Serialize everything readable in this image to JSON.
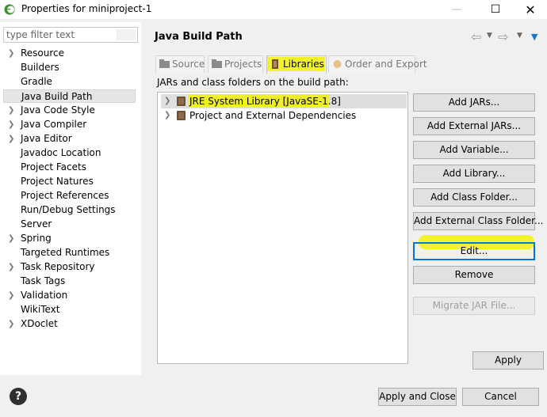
{
  "window": {
    "title": "Properties for miniproject-1",
    "minimize": "—",
    "maximize": "☐",
    "close": "✕"
  },
  "filter": {
    "placeholder": "type filter text"
  },
  "tree": [
    {
      "label": "Resource",
      "arrow": true
    },
    {
      "label": "Builders",
      "arrow": false
    },
    {
      "label": "Gradle",
      "arrow": false
    },
    {
      "label": "Java Build Path",
      "arrow": false,
      "selected": true
    },
    {
      "label": "Java Code Style",
      "arrow": true
    },
    {
      "label": "Java Compiler",
      "arrow": true
    },
    {
      "label": "Java Editor",
      "arrow": true
    },
    {
      "label": "Javadoc Location",
      "arrow": false
    },
    {
      "label": "Project Facets",
      "arrow": false
    },
    {
      "label": "Project Natures",
      "arrow": false
    },
    {
      "label": "Project References",
      "arrow": false
    },
    {
      "label": "Run/Debug Settings",
      "arrow": false
    },
    {
      "label": "Server",
      "arrow": false
    },
    {
      "label": "Spring",
      "arrow": true
    },
    {
      "label": "Targeted Runtimes",
      "arrow": false
    },
    {
      "label": "Task Repository",
      "arrow": true
    },
    {
      "label": "Task Tags",
      "arrow": false
    },
    {
      "label": "Validation",
      "arrow": true
    },
    {
      "label": "WikiText",
      "arrow": false
    },
    {
      "label": "XDoclet",
      "arrow": true
    }
  ],
  "page": {
    "title": "Java Build Path"
  },
  "tabs": [
    {
      "label": "Source",
      "icon": "source-icon",
      "active": false
    },
    {
      "label": "Projects",
      "icon": "projects-icon",
      "active": false
    },
    {
      "label": "Libraries",
      "icon": "libraries-icon",
      "active": true
    },
    {
      "label": "Order and Export",
      "icon": "order-export-icon",
      "active": false
    }
  ],
  "libraries": {
    "heading": "JARs and class folders on the build path:",
    "entries": [
      {
        "label": "JRE System Library [JavaSE-1.8]",
        "selected": true
      },
      {
        "label": "Project and External Dependencies",
        "selected": false
      }
    ]
  },
  "buttons": {
    "add_jars": "Add JARs...",
    "add_external_jars": "Add External JARs...",
    "add_variable": "Add Variable...",
    "add_library": "Add Library...",
    "add_class_folder": "Add Class Folder...",
    "add_external_class_folder": "Add External Class Folder...",
    "edit": "Edit...",
    "remove": "Remove",
    "migrate_jar": "Migrate JAR File...",
    "apply": "Apply",
    "apply_and_close": "Apply and Close",
    "cancel": "Cancel"
  },
  "help": {
    "icon": "help-icon",
    "glyph": "?"
  },
  "colors": {
    "highlight": "#f3f30a",
    "focus": "#0078d7",
    "selected_tree": "#e6e6e6"
  }
}
